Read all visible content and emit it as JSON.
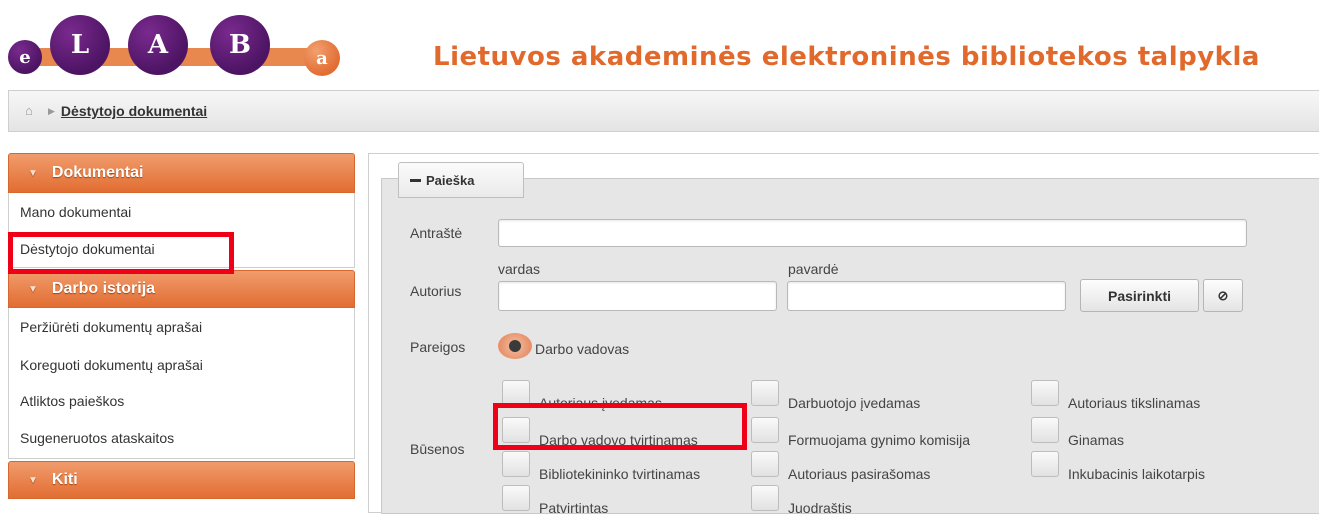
{
  "header": {
    "logo_letters": [
      "e",
      "L",
      "A",
      "B",
      "a"
    ],
    "site_title": "Lietuvos akademinės elektroninės bibliotekos talpykla"
  },
  "breadcrumb": {
    "current": "Dėstytojo dokumentai"
  },
  "sidebar": {
    "sections": [
      {
        "title": "Dokumentai",
        "items": [
          "Mano dokumentai",
          "Dėstytojo dokumentai"
        ]
      },
      {
        "title": "Darbo istorija",
        "items": [
          "Peržiūrėti dokumentų aprašai",
          "Koreguoti dokumentų aprašai",
          "Atliktos paieškos",
          "Sugeneruotos ataskaitos"
        ]
      },
      {
        "title": "Kiti",
        "items": []
      }
    ]
  },
  "search": {
    "tab_label": "Paieška",
    "title_label": "Antraštė",
    "title_value": "",
    "author_label": "Autorius",
    "first_name_label": "vardas",
    "first_name_value": "",
    "last_name_label": "pavardė",
    "last_name_value": "",
    "choose_button": "Pasirinkti",
    "clear_icon": "⊘",
    "role_label": "Pareigos",
    "role_option": "Darbo vadovas",
    "status_label": "Būsenos",
    "statuses": [
      [
        "Autoriaus įvedamas",
        "Darbuotojo įvedamas",
        "Autoriaus tikslinamas"
      ],
      [
        "Darbo vadovo tvirtinamas",
        "Formuojama gynimo komisija",
        "Ginamas"
      ],
      [
        "Bibliotekininko tvirtinamas",
        "Autoriaus pasirašomas",
        "Inkubacinis laikotarpis"
      ],
      [
        "Patvirtintas",
        "Juodraštis"
      ]
    ]
  },
  "colors": {
    "accent": "#e26d32",
    "highlight": "#f00016",
    "logo_purple": "#4c1463"
  }
}
